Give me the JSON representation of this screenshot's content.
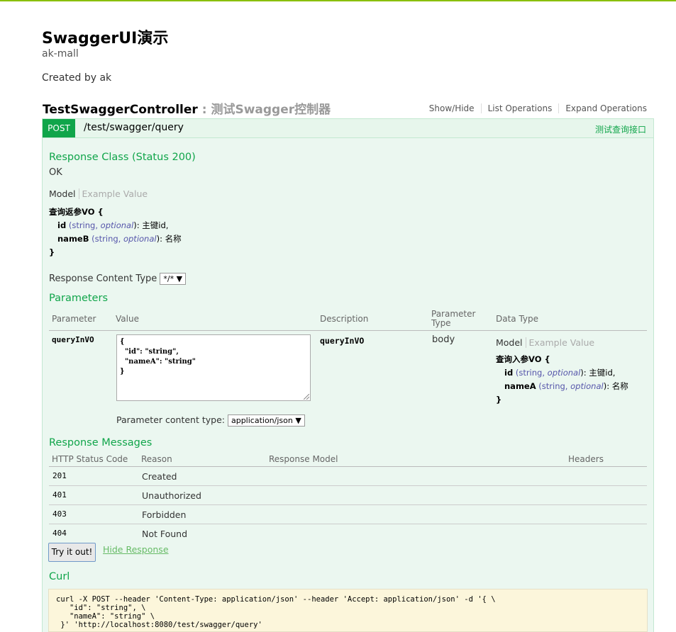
{
  "page": {
    "title": "SwaggerUI演示",
    "subtitle": "ak-mall",
    "created_by": "Created by ak"
  },
  "controller": {
    "name": "TestSwaggerController",
    "description": " : 测试Swagger控制器",
    "actions": [
      "Show/Hide",
      "List Operations",
      "Expand Operations"
    ]
  },
  "operation": {
    "method": "POST",
    "path": "/test/swagger/query",
    "summary": "测试查询接口"
  },
  "response_class": {
    "heading": "Response Class (Status 200)",
    "status_text": "OK",
    "tab_model": "Model",
    "tab_example": "Example Value",
    "model": {
      "name": "查询返参VO {",
      "props": [
        {
          "name": "id",
          "type": "(string,",
          "opt": "optional",
          "desc": "): 主键id,"
        },
        {
          "name": "nameB",
          "type": "(string,",
          "opt": "optional",
          "desc": "): 名称"
        }
      ],
      "close": "}"
    }
  },
  "response_content_type": {
    "label": "Response Content Type",
    "value": "*/*"
  },
  "parameters": {
    "heading": "Parameters",
    "headers": [
      "Parameter",
      "Value",
      "Description",
      "Parameter Type",
      "Data Type"
    ],
    "row": {
      "name": "queryInVO",
      "value": "{\n  \"id\": \"string\",\n  \"nameA\": \"string\"\n}",
      "description": "queryInVO",
      "param_type": "body",
      "tab_model": "Model",
      "tab_example": "Example Value",
      "model": {
        "name": "查询入参VO {",
        "props": [
          {
            "name": "id",
            "type": "(string,",
            "opt": "optional",
            "desc": "): 主键id,"
          },
          {
            "name": "nameA",
            "type": "(string,",
            "opt": "optional",
            "desc": "): 名称"
          }
        ],
        "close": "}"
      }
    },
    "content_type_label": "Parameter content type:",
    "content_type_value": "application/json"
  },
  "response_messages": {
    "heading": "Response Messages",
    "headers": [
      "HTTP Status Code",
      "Reason",
      "Response Model",
      "Headers"
    ],
    "rows": [
      {
        "code": "201",
        "reason": "Created"
      },
      {
        "code": "401",
        "reason": "Unauthorized"
      },
      {
        "code": "403",
        "reason": "Forbidden"
      },
      {
        "code": "404",
        "reason": "Not Found"
      }
    ]
  },
  "buttons": {
    "try_it_out": "Try it out!",
    "hide_response": "Hide Response"
  },
  "curl": {
    "heading": "Curl",
    "command": "curl -X POST --header 'Content-Type: application/json' --header 'Accept: application/json' -d '{ \\\n   \"id\": \"string\", \\\n   \"nameA\": \"string\" \\\n }' 'http://localhost:8080/test/swagger/query'"
  },
  "colors": {
    "accent": "#10a54a",
    "top_bar": "#89bf04",
    "op_bg": "#ebf7f0",
    "curl_bg": "#fcf6db"
  }
}
